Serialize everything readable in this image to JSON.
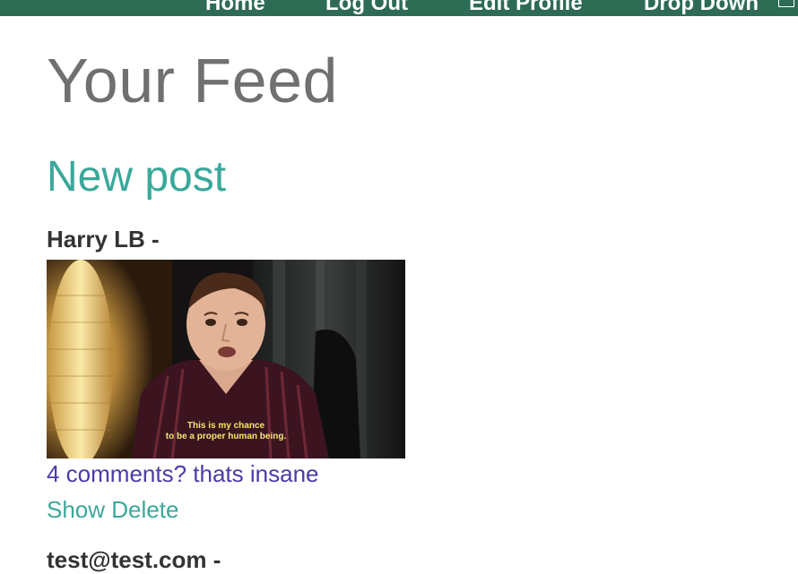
{
  "nav": {
    "home": "Home",
    "logout": "Log Out",
    "edit_profile": "Edit Profile",
    "drop_down": "Drop Down"
  },
  "page_title": "Your Feed",
  "new_post_label": "New post",
  "posts": [
    {
      "author": "Harry LB -",
      "image_subtitle_line1": "This is my chance",
      "image_subtitle_line2": "to be a proper human being.",
      "caption": "4 comments? thats insane",
      "show_label": "Show",
      "delete_label": "Delete"
    },
    {
      "author": "test@test.com -"
    }
  ],
  "colors": {
    "navbar": "#2e6b55",
    "title": "#707070",
    "accent_teal": "#3aa89a",
    "caption_purple": "#4b3aa8",
    "author": "#333333"
  }
}
